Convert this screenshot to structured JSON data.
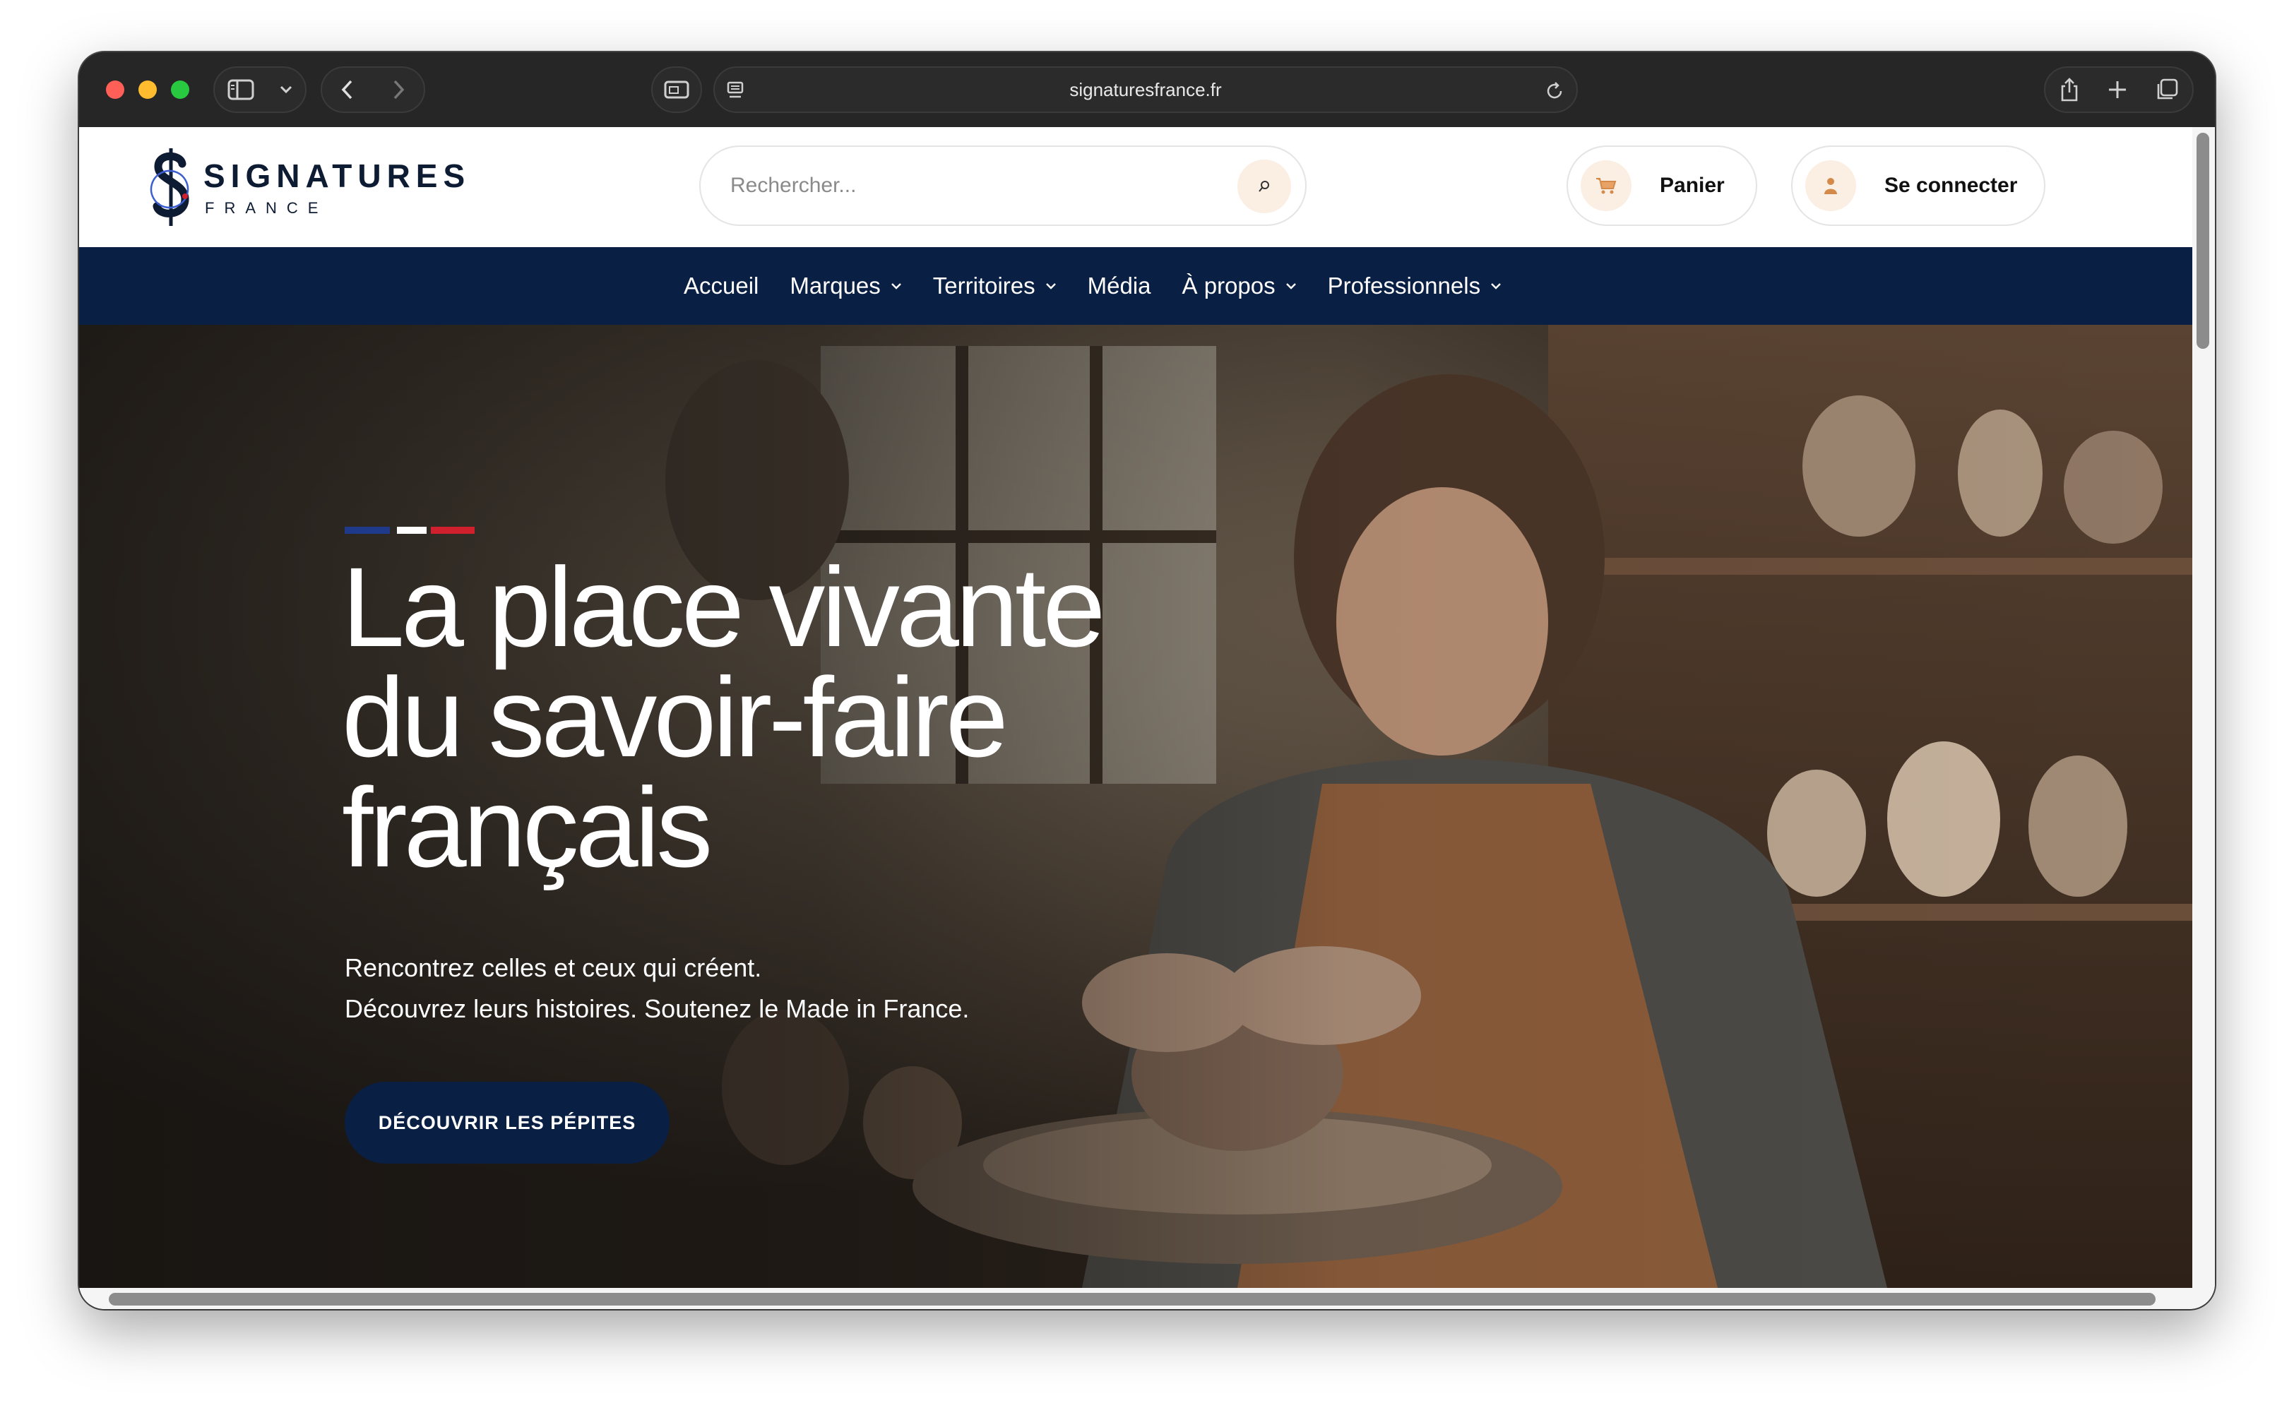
{
  "browser": {
    "url": "signaturesfrance.fr"
  },
  "site": {
    "logo_title": "SIGNATURES",
    "logo_subtitle": "FRANCE",
    "search_placeholder": "Rechercher...",
    "cart_label": "Panier",
    "login_label": "Se connecter"
  },
  "nav": {
    "items": [
      {
        "label": "Accueil"
      },
      {
        "label": "Marques"
      },
      {
        "label": "Territoires"
      },
      {
        "label": "Média"
      },
      {
        "label": "À propos"
      },
      {
        "label": "Professionnels"
      }
    ]
  },
  "hero": {
    "title_line1": "La place vivante",
    "title_line2": "du savoir-faire",
    "title_line3": "français",
    "subtitle_line1": "Rencontrez celles et ceux qui créent.",
    "subtitle_line2": "Découvrez leurs histoires. Soutenez le Made in France.",
    "cta_label": "DÉCOUVRIR LES PÉPITES"
  },
  "colors": {
    "navy": "#0a1f44",
    "accent_light": "#fbeee2",
    "flag_blue": "#1f3a8a",
    "flag_white": "#ffffff",
    "flag_red": "#d0202e"
  }
}
